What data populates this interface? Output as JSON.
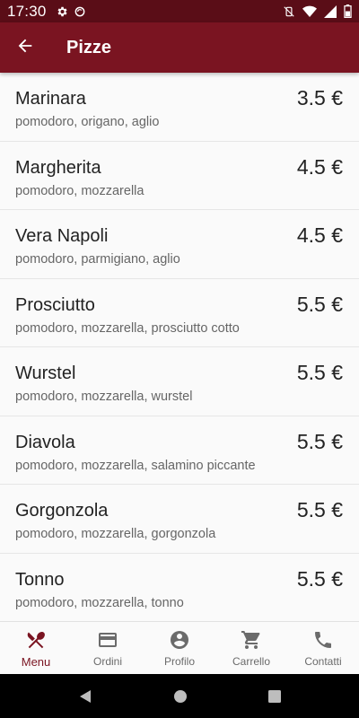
{
  "status_bar": {
    "time": "17:30",
    "icons": [
      "settings-icon",
      "sync-icon",
      "vibrate-off-icon",
      "wifi-icon",
      "signal-icon",
      "battery-icon"
    ]
  },
  "app_bar": {
    "title": "Pizze",
    "back_icon": "arrow-back-icon"
  },
  "menu": {
    "items": [
      {
        "name": "Marinara",
        "desc": "pomodoro, origano, aglio",
        "price": "3.5 €"
      },
      {
        "name": "Margherita",
        "desc": "pomodoro, mozzarella",
        "price": "4.5 €"
      },
      {
        "name": "Vera Napoli",
        "desc": "pomodoro, parmigiano, aglio",
        "price": "4.5 €"
      },
      {
        "name": "Prosciutto",
        "desc": "pomodoro, mozzarella, prosciutto cotto",
        "price": "5.5 €"
      },
      {
        "name": "Wurstel",
        "desc": "pomodoro, mozzarella, wurstel",
        "price": "5.5 €"
      },
      {
        "name": "Diavola",
        "desc": "pomodoro, mozzarella, salamino piccante",
        "price": "5.5 €"
      },
      {
        "name": "Gorgonzola",
        "desc": "pomodoro, mozzarella, gorgonzola",
        "price": "5.5 €"
      },
      {
        "name": "Tonno",
        "desc": "pomodoro, mozzarella, tonno",
        "price": "5.5 €"
      }
    ]
  },
  "bottom_nav": {
    "items": [
      {
        "label": "Menu",
        "icon": "cutlery-icon",
        "active": true
      },
      {
        "label": "Ordini",
        "icon": "credit-card-icon",
        "active": false
      },
      {
        "label": "Profilo",
        "icon": "account-circle-icon",
        "active": false
      },
      {
        "label": "Carrello",
        "icon": "cart-icon",
        "active": false
      },
      {
        "label": "Contatti",
        "icon": "phone-icon",
        "active": false
      }
    ]
  },
  "colors": {
    "status_bar": "#5a0d17",
    "app_bar": "#7a1421",
    "accent": "#7a1421",
    "nav_inactive": "#6b6b6b"
  },
  "system_nav": {
    "icons": [
      "back-triangle-icon",
      "home-circle-icon",
      "recents-square-icon"
    ]
  }
}
